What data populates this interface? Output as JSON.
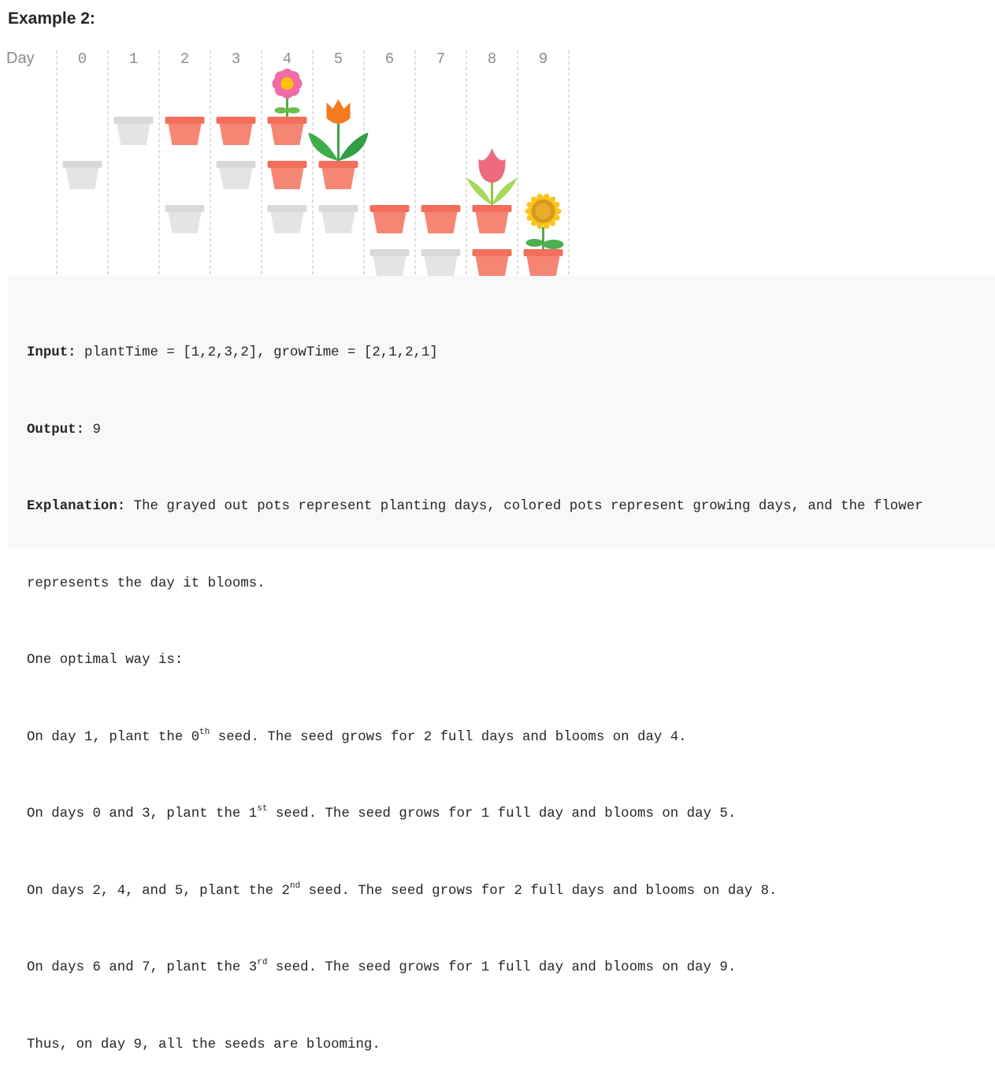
{
  "heading": "Example 2:",
  "figure": {
    "day_label": "Day",
    "days": [
      "0",
      "1",
      "2",
      "3",
      "4",
      "5",
      "6",
      "7",
      "8",
      "9"
    ],
    "plants": [
      {
        "seed": 0,
        "plant_days": [
          1
        ],
        "grow_days": [
          2,
          3,
          4
        ],
        "bloom_day": 4,
        "flower": "pink-daisy"
      },
      {
        "seed": 1,
        "plant_days": [
          0,
          3
        ],
        "grow_days": [
          4,
          5
        ],
        "bloom_day": 5,
        "flower": "orange-tulip"
      },
      {
        "seed": 2,
        "plant_days": [
          2,
          4,
          5
        ],
        "grow_days": [
          6,
          7,
          8
        ],
        "bloom_day": 8,
        "flower": "pink-tulip"
      },
      {
        "seed": 3,
        "plant_days": [
          6,
          7
        ],
        "grow_days": [
          8,
          9
        ],
        "bloom_day": 9,
        "flower": "sunflower"
      }
    ],
    "colors": {
      "planting_pot": "#d9d9d9",
      "growing_pot": "#f26f5c",
      "dashed_line": "#bfbfbf",
      "day_label": "#8c8c8c"
    }
  },
  "example": {
    "input_label": "Input:",
    "input_value": " plantTime = [1,2,3,2], growTime = [2,1,2,1]",
    "output_label": "Output:",
    "output_value": " 9",
    "explanation_label": "Explanation:",
    "explanation_line1": " The grayed out pots represent planting days, colored pots represent growing days, and the flower",
    "explanation_line2": "represents the day it blooms.",
    "line_optimal": "One optimal way is:",
    "line_seed0_a": "On day 1, plant the 0",
    "line_seed0_sup": "th",
    "line_seed0_b": " seed. The seed grows for 2 full days and blooms on day 4.",
    "line_seed1_a": "On days 0 and 3, plant the 1",
    "line_seed1_sup": "st",
    "line_seed1_b": " seed. The seed grows for 1 full day and blooms on day 5.",
    "line_seed2_a": "On days 2, 4, and 5, plant the 2",
    "line_seed2_sup": "nd",
    "line_seed2_b": " seed. The seed grows for 2 full days and blooms on day 8.",
    "line_seed3_a": "On days 6 and 7, plant the 3",
    "line_seed3_sup": "rd",
    "line_seed3_b": " seed. The seed grows for 1 full day and blooms on day 9.",
    "line_thus": "Thus, on day 9, all the seeds are blooming."
  }
}
